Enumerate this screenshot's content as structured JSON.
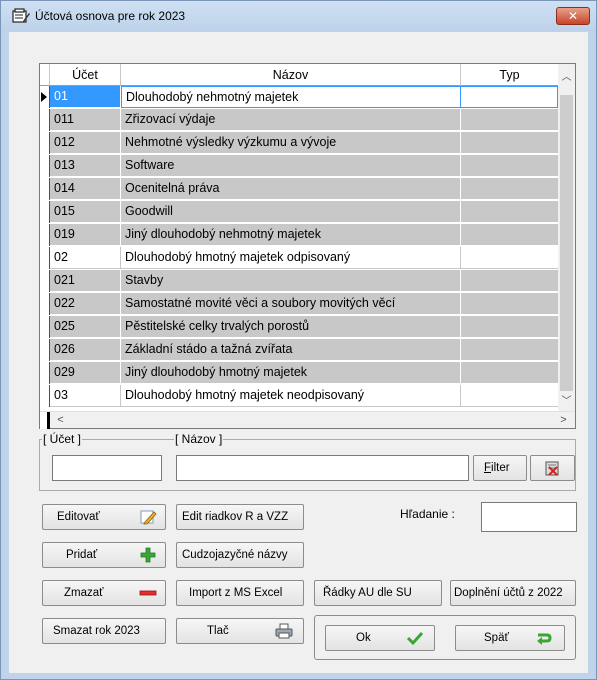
{
  "window": {
    "title": "Účtová osnova pre rok 2023",
    "close_glyph": "✕"
  },
  "grid": {
    "headers": [
      "Účet",
      "Názov",
      "Typ"
    ],
    "rows": [
      {
        "ucet": "01",
        "nazov": "Dlouhodobý nehmotný majetek",
        "typ": "",
        "style": "sel"
      },
      {
        "ucet": "011",
        "nazov": "Zřizovací výdaje",
        "typ": "",
        "style": "gray"
      },
      {
        "ucet": "012",
        "nazov": "Nehmotné výsledky výzkumu a vývoje",
        "typ": "",
        "style": "gray"
      },
      {
        "ucet": "013",
        "nazov": "Software",
        "typ": "",
        "style": "gray"
      },
      {
        "ucet": "014",
        "nazov": "Ocenitelná práva",
        "typ": "",
        "style": "gray"
      },
      {
        "ucet": "015",
        "nazov": "Goodwill",
        "typ": "",
        "style": "gray"
      },
      {
        "ucet": "019",
        "nazov": "Jiný dlouhodobý nehmotný majetek",
        "typ": "",
        "style": "gray"
      },
      {
        "ucet": "02",
        "nazov": "Dlouhodobý hmotný majetek odpisovaný",
        "typ": "",
        "style": "white"
      },
      {
        "ucet": "021",
        "nazov": "Stavby",
        "typ": "",
        "style": "gray"
      },
      {
        "ucet": "022",
        "nazov": "Samostatné movité věci a soubory movitých věcí",
        "typ": "",
        "style": "gray"
      },
      {
        "ucet": "025",
        "nazov": "Pěstitelské celky trvalých porostů",
        "typ": "",
        "style": "gray"
      },
      {
        "ucet": "026",
        "nazov": "Základní stádo a tažná zvířata",
        "typ": "",
        "style": "gray"
      },
      {
        "ucet": "029",
        "nazov": "Jiný dlouhodobý hmotný majetek",
        "typ": "",
        "style": "gray"
      },
      {
        "ucet": "03",
        "nazov": "Dlouhodobý hmotný majetek neodpisovaný",
        "typ": "",
        "style": "white"
      }
    ]
  },
  "filter": {
    "ucet_label": "[ Účet ]",
    "nazov_label": "[ Názov ]",
    "ucet_value": "",
    "nazov_value": "",
    "filter_button": "Filter",
    "filter_underline": "F"
  },
  "search": {
    "label": "Hľadanie :",
    "value": ""
  },
  "buttons": {
    "editovat": "Editovať",
    "pridat": "Pridať",
    "zmazat": "Zmazať",
    "smazat_rok": "Smazat rok 2023",
    "edit_riadkov": "Edit riadkov R a VZZ",
    "cudzojazycne": "Cudzojazyčné názvy",
    "import_excel": "Import z MS Excel",
    "tlac": "Tlač",
    "radky_au": "Řádky AU dle SU",
    "doplneni": "Doplnění účtů z 2022",
    "ok": "Ok",
    "spat": "Späť"
  },
  "colors": {
    "titlebar": "#bfd3ea",
    "selection": "#3399ff",
    "row_gray": "#c8c8c8",
    "green_icon": "#3aa635",
    "red_icon": "#e03030"
  }
}
